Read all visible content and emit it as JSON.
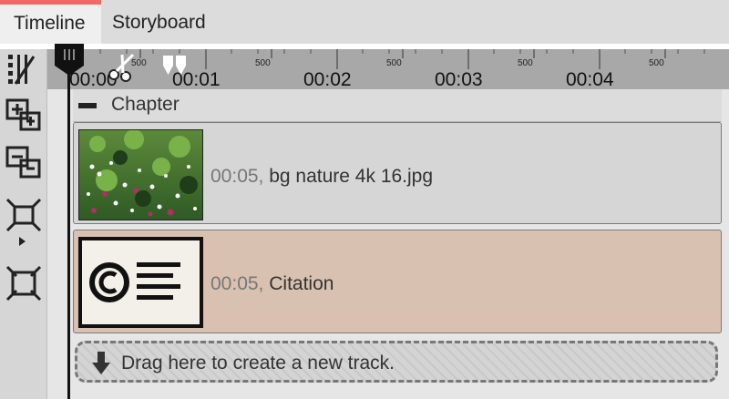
{
  "tabs": [
    {
      "label": "Timeline",
      "active": true
    },
    {
      "label": "Storyboard",
      "active": false
    }
  ],
  "toolbar": {
    "tools": [
      {
        "icon": "adjust-speed-icon"
      },
      {
        "icon": "expand-tracks-icon"
      },
      {
        "icon": "collapse-tracks-icon"
      },
      {
        "icon": "zoom-fit-icon"
      },
      {
        "icon": "zoom-expand-icon"
      }
    ]
  },
  "ruler": {
    "labels": [
      "00:00",
      "00:01",
      "00:02",
      "00:03",
      "00:04"
    ],
    "sub_labels": [
      "500",
      "500",
      "500",
      "500",
      "500"
    ]
  },
  "chapter": {
    "label": "Chapter"
  },
  "clips": [
    {
      "duration": "00:05,",
      "name": "bg nature 4k 16.jpg",
      "color": "#d6d6d6"
    },
    {
      "duration": "00:05,",
      "name": "Citation",
      "color": "#d8c1b0"
    }
  ],
  "new_track": {
    "label": "Drag here to create a new track."
  },
  "colors": {
    "accent": "#f06a6a",
    "citation_bg": "#d8c1b0"
  }
}
